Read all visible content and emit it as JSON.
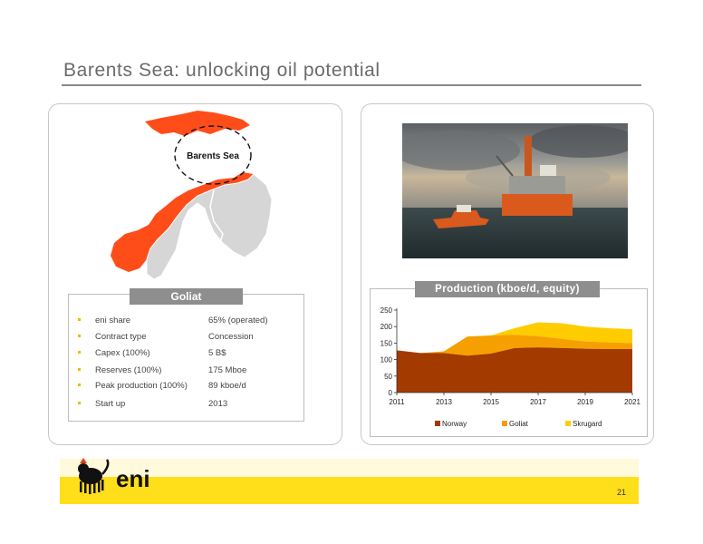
{
  "title": "Barents Sea: unlocking oil potential",
  "map": {
    "label": "Barents Sea"
  },
  "goliat": {
    "heading": "Goliat",
    "rows": [
      {
        "label": "eni share",
        "value": "65% (operated)"
      },
      {
        "label": "Contract type",
        "value": "Concession"
      },
      {
        "label": "Capex (100%)",
        "value": "5 B$"
      },
      {
        "label": "Reserves  (100%)",
        "value": "175 Mboe"
      },
      {
        "label": "Peak production (100%)",
        "value": "89 kboe/d"
      },
      {
        "label": "Start up",
        "value": "2013"
      }
    ]
  },
  "chart_data": {
    "type": "area",
    "title": "Production (kboe/d, equity)",
    "stacked": true,
    "x": [
      2011,
      2012,
      2013,
      2014,
      2015,
      2016,
      2017,
      2018,
      2019,
      2020,
      2021
    ],
    "x_ticks": [
      "2011",
      "2013",
      "2015",
      "2017",
      "2019",
      "2021"
    ],
    "y_ticks": [
      "0",
      "50",
      "100",
      "150",
      "200",
      "250"
    ],
    "ylim": [
      0,
      250
    ],
    "legend_position": "bottom",
    "series": [
      {
        "name": "Norway",
        "color": "#a33a00",
        "values": [
          128,
          120,
          120,
          112,
          118,
          135,
          137,
          135,
          133,
          132,
          132
        ]
      },
      {
        "name": "Goliat",
        "color": "#f5a000",
        "values": [
          0,
          0,
          5,
          58,
          55,
          40,
          34,
          28,
          22,
          20,
          18
        ]
      },
      {
        "name": "Skrugard",
        "color": "#ffcc00",
        "values": [
          0,
          0,
          0,
          0,
          0,
          20,
          42,
          47,
          45,
          43,
          42
        ]
      }
    ]
  },
  "page_number": "21",
  "logo": {
    "text": "eni",
    "icon": "six-legged-dog-logo"
  }
}
